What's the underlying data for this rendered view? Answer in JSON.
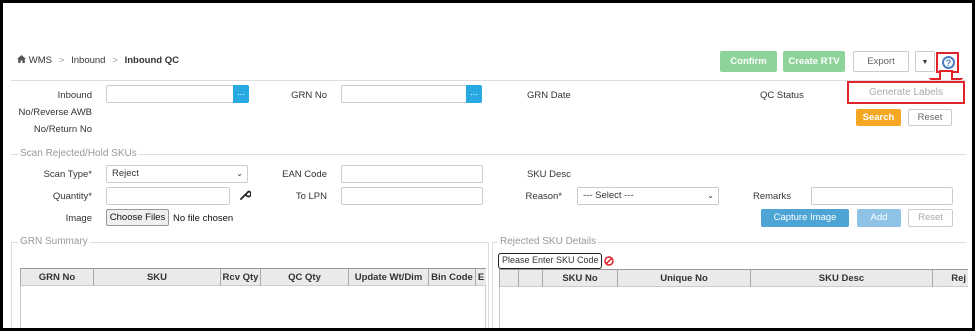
{
  "breadcrumb": {
    "home_label": "WMS",
    "sep1": ">",
    "item2": "Inbound",
    "sep2": ">",
    "current": "Inbound QC"
  },
  "toolbar": {
    "confirm": "Confirm",
    "create_rtv": "Create RTV",
    "export": "Export",
    "generate_labels": "Generate Labels"
  },
  "header_form": {
    "inbound_label_1": "Inbound",
    "inbound_label_2": "No/Reverse AWB",
    "inbound_label_3": "No/Return No",
    "inbound_value": "",
    "grn_no_label": "GRN No",
    "grn_no_value": "",
    "grn_date_label": "GRN Date",
    "qc_status_label": "QC Status",
    "lookup_glyph": "...",
    "search": "Search",
    "reset": "Reset"
  },
  "scan_section": {
    "legend": "Scan Rejected/Hold SKUs",
    "scan_type_label": "Scan Type*",
    "scan_type_value": "Reject",
    "ean_code_label": "EAN Code",
    "sku_desc_label": "SKU Desc",
    "quantity_label": "Quantity*",
    "to_lpn_label": "To LPN",
    "reason_label": "Reason*",
    "reason_value": "--- Select ---",
    "remarks_label": "Remarks",
    "image_label": "Image",
    "choose_files": "Choose Files",
    "no_file": "No file chosen",
    "capture_image": "Capture Image",
    "add": "Add",
    "reset": "Reset"
  },
  "grn_summary": {
    "legend": "GRN Summary",
    "columns": [
      "GRN No",
      "SKU",
      "Rcv Qty",
      "QC Qty",
      "Update Wt/Dim",
      "Bin Code",
      "E"
    ]
  },
  "rejected_details": {
    "legend": "Rejected SKU Details",
    "sku_placeholder": "Please Enter SKU Code",
    "columns": [
      "",
      "SKU No",
      "Unique No",
      "SKU Desc",
      "Rej"
    ]
  },
  "colors": {
    "green": "#8ed39a",
    "orange": "#f5a623",
    "blue": "#4fa4d6",
    "lookup_blue": "#29a9e1",
    "highlight_red": "#e0242a"
  }
}
